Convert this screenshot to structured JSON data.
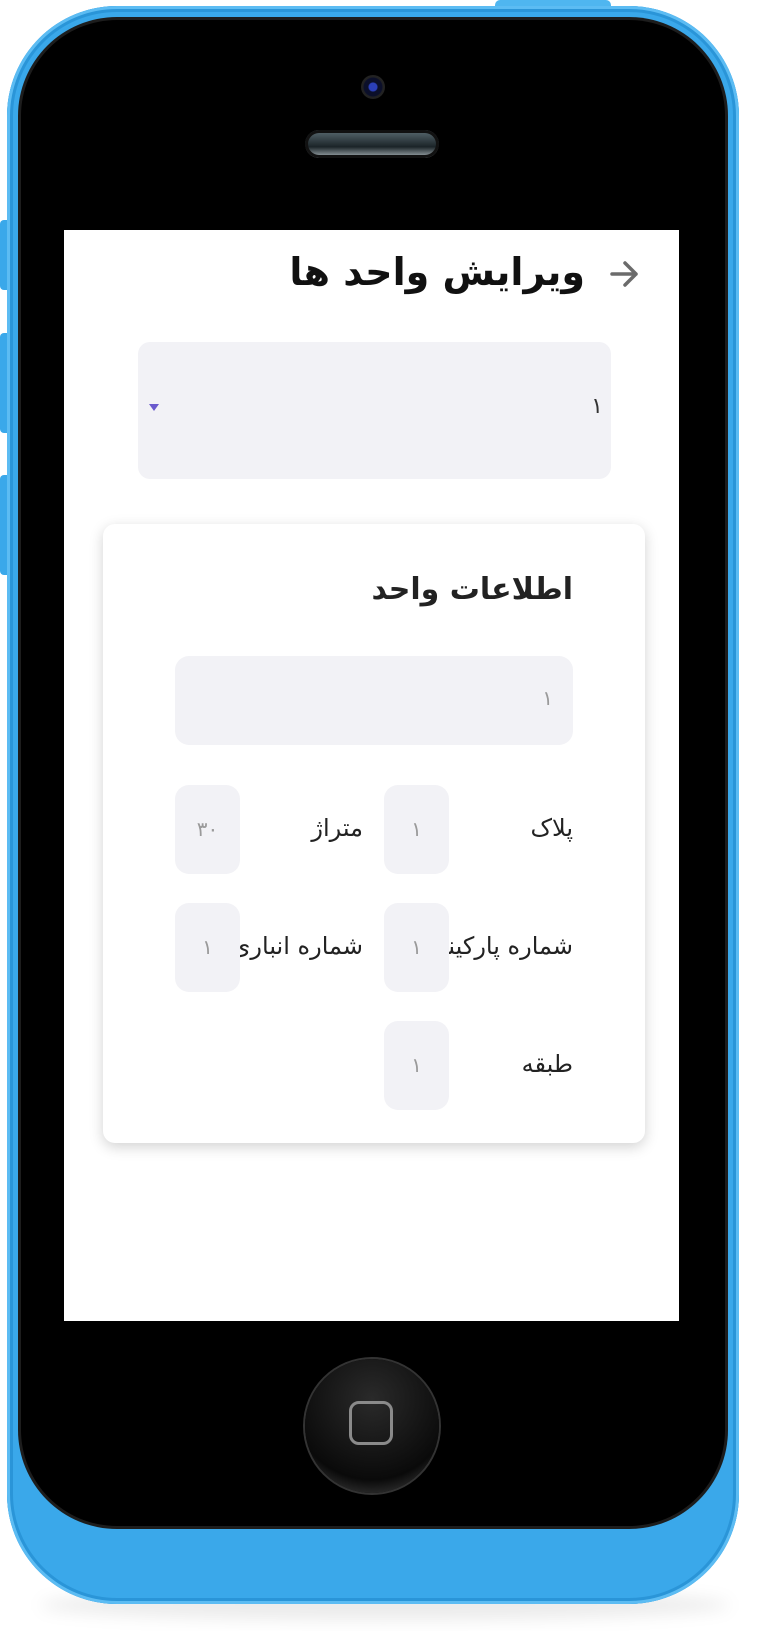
{
  "header": {
    "title": "ویرایش واحد ها",
    "back_icon": "arrow-right-icon"
  },
  "unit_select": {
    "value": "۱",
    "dropdown_icon": "caret-down-icon",
    "accent": "#6a5acd"
  },
  "card": {
    "title": "اطلاعات واحد",
    "unit_name_value": "۱",
    "fields": {
      "plak": {
        "label": "پلاک",
        "value": "۱"
      },
      "metraj": {
        "label": "متراژ",
        "value": "۳۰"
      },
      "parking": {
        "label": "شماره پارکینگ",
        "value": "۱"
      },
      "anbari": {
        "label": "شماره انباری",
        "value": "۱"
      },
      "tabaghe": {
        "label": "طبقه",
        "value": "۱"
      }
    }
  },
  "colors": {
    "phone_body": "#3aa8ea",
    "input_bg": "#f2f2f6"
  }
}
